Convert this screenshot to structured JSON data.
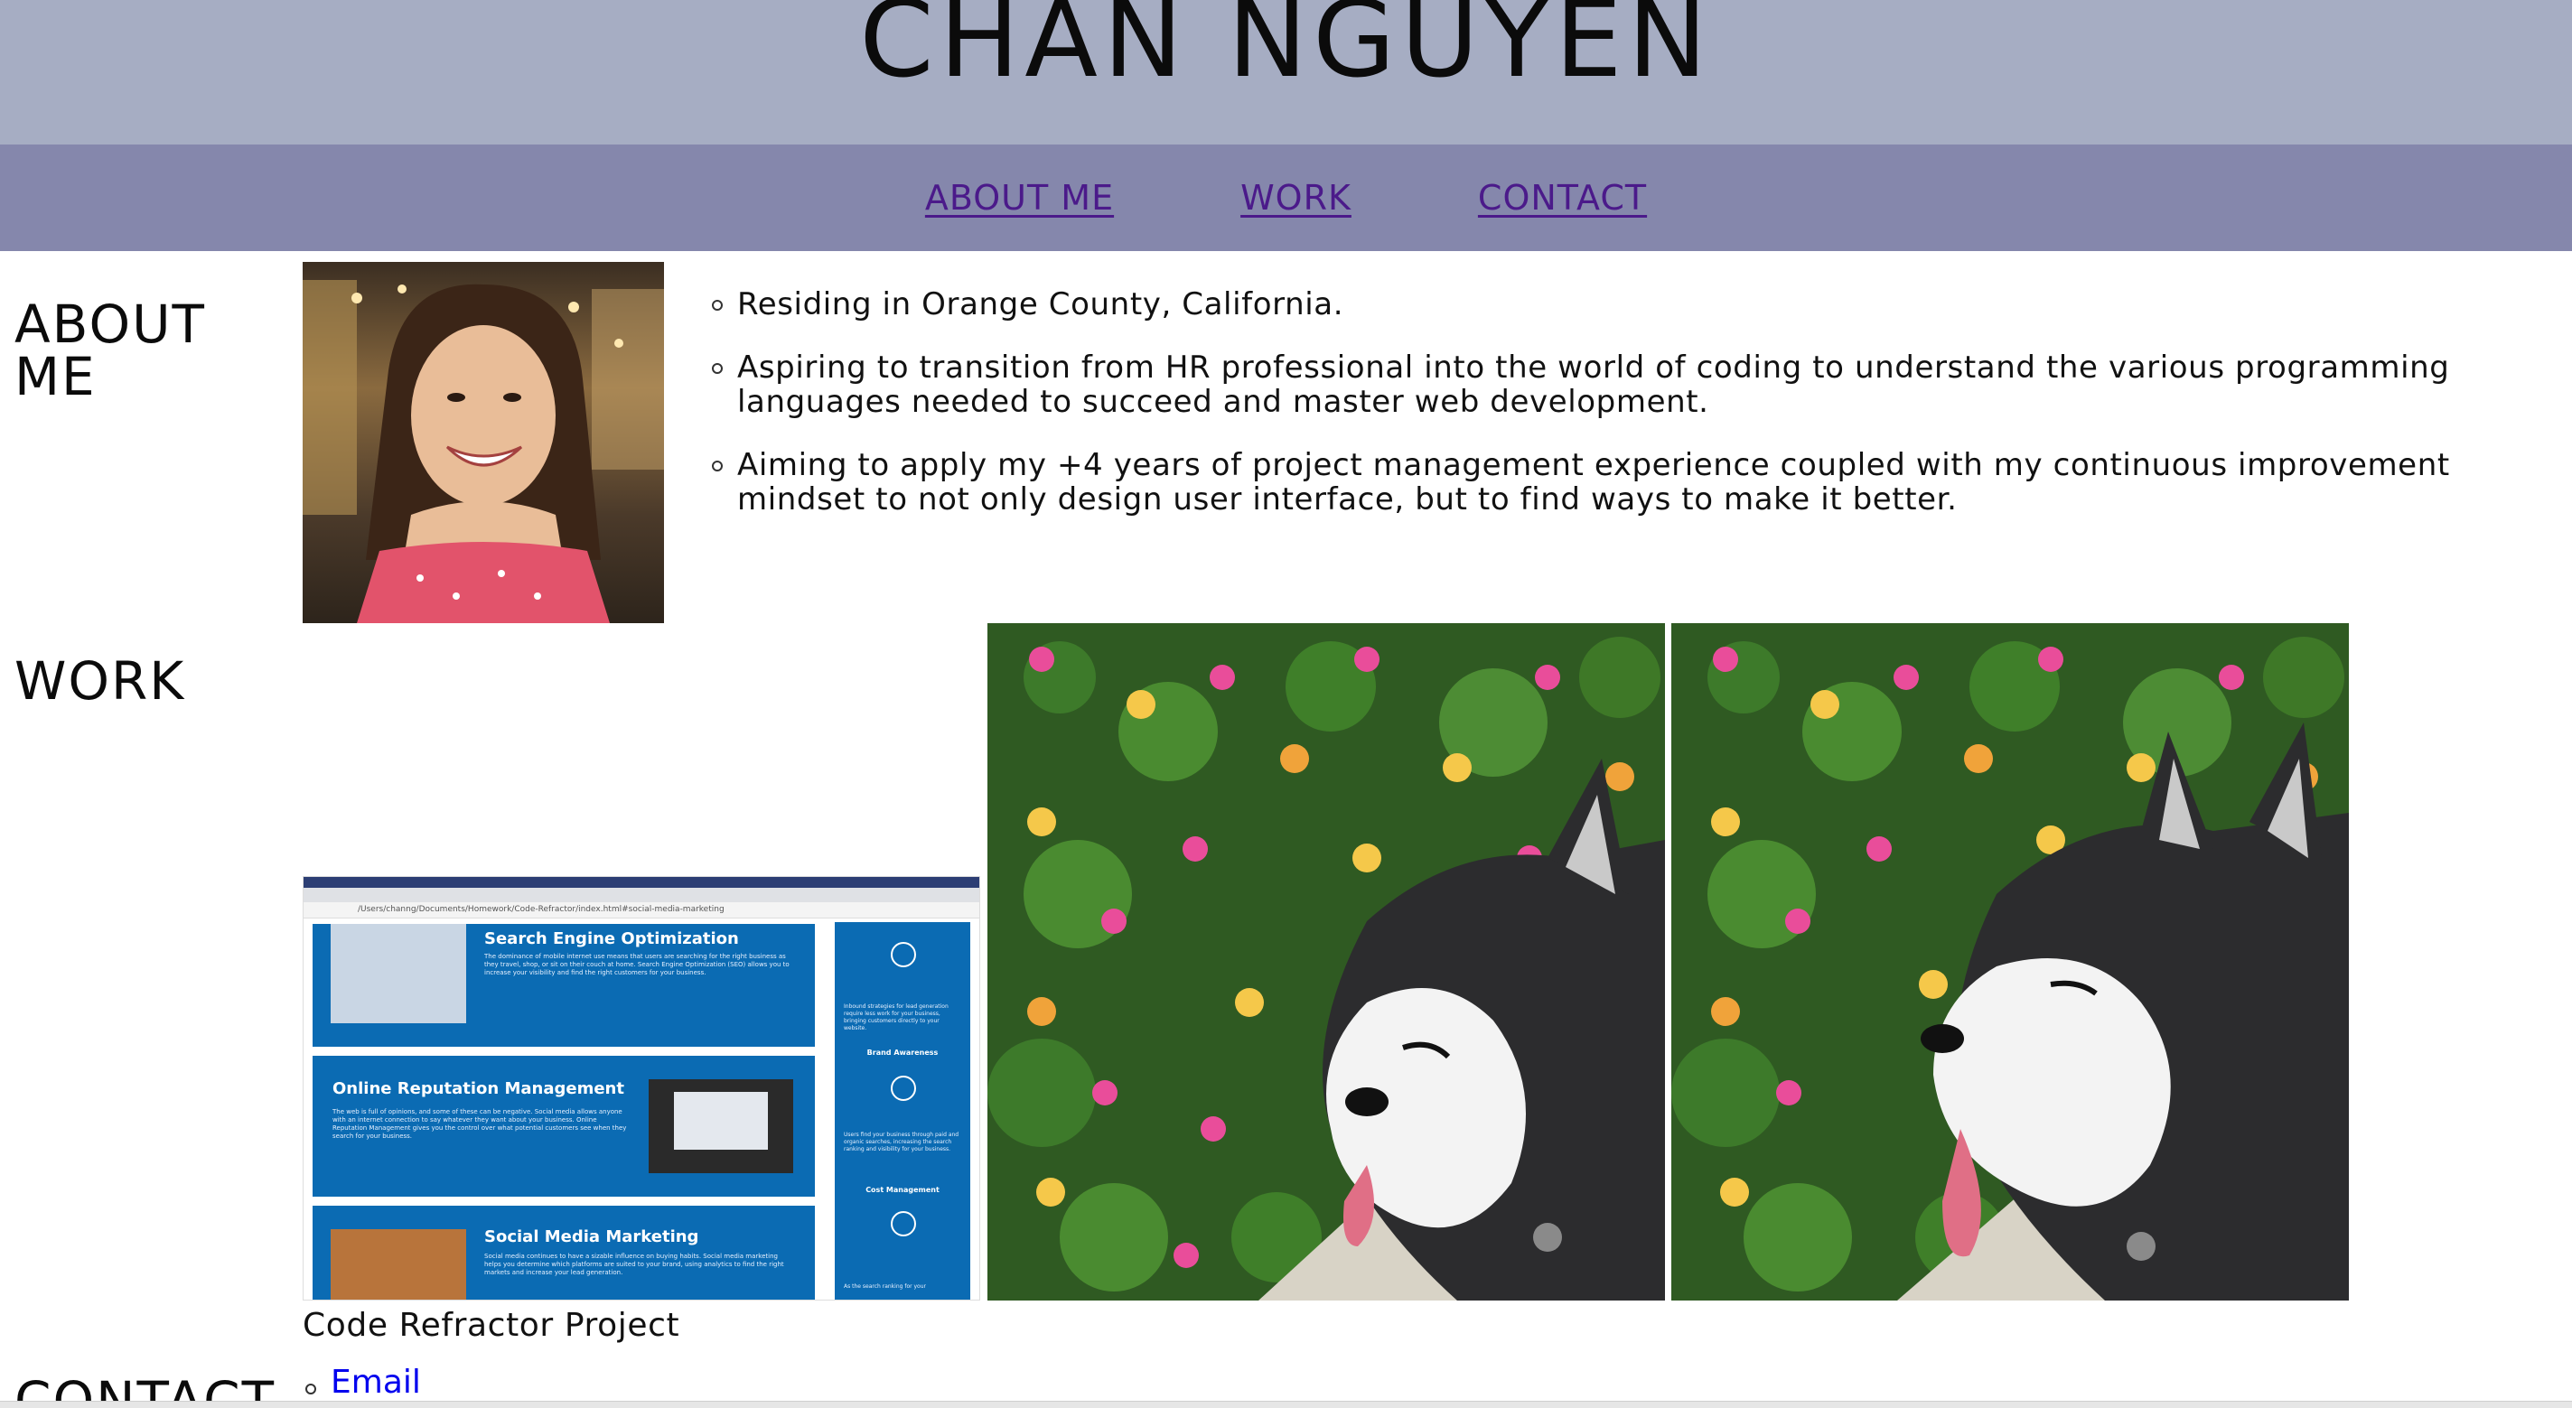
{
  "header": {
    "title": "CHAN NGUYEN"
  },
  "nav": {
    "items": [
      {
        "label": "ABOUT ME"
      },
      {
        "label": "WORK"
      },
      {
        "label": "CONTACT"
      }
    ]
  },
  "about": {
    "heading": "ABOUT ME",
    "bullets": [
      "Residing in Orange County, California.",
      "Aspiring to transition from HR professional into the world of coding to understand the various programming languages needed to succeed and master web development.",
      "Aiming to apply my +4 years of project management experience coupled with my continuous improvement mindset to not only design user interface, but to find ways to make it better."
    ]
  },
  "work": {
    "heading": "WORK",
    "caption": "Code Refractor Project",
    "screenshot": {
      "url": "/Users/channg/Documents/Homework/Code-Refractor/index.html#social-media-marketing",
      "cards": [
        {
          "title": "Search Engine Optimization",
          "body": "The dominance of mobile internet use means that users are searching for the right business as they travel, shop, or sit on their couch at home. Search Engine Optimization (SEO) allows you to increase your visibility and find the right customers for your business."
        },
        {
          "title": "Online Reputation Management",
          "body": "The web is full of opinions, and some of these can be negative. Social media allows anyone with an internet connection to say whatever they want about your business. Online Reputation Management gives you the control over what potential customers see when they search for your business."
        },
        {
          "title": "Social Media Marketing",
          "body": "Social media continues to have a sizable influence on buying habits. Social media marketing helps you determine which platforms are suited to your brand, using analytics to find the right markets and increase your lead generation."
        }
      ],
      "side": [
        {
          "label": "",
          "body": "Inbound strategies for lead generation require less work for your business, bringing customers directly to your website."
        },
        {
          "label": "Brand Awareness",
          "body": "Users find your business through paid and organic searches, increasing the search ranking and visibility for your business."
        },
        {
          "label": "Cost Management",
          "body": "As the search ranking for your"
        }
      ]
    }
  },
  "contact": {
    "heading": "CONTACT",
    "links": [
      {
        "label": "Email"
      }
    ]
  },
  "colors": {
    "header_bg": "#a6adc3",
    "nav_bg": "#8587ac",
    "nav_link": "#4b1a8a",
    "contact_link": "#0000ee",
    "card_blue": "#0b6bb3"
  }
}
